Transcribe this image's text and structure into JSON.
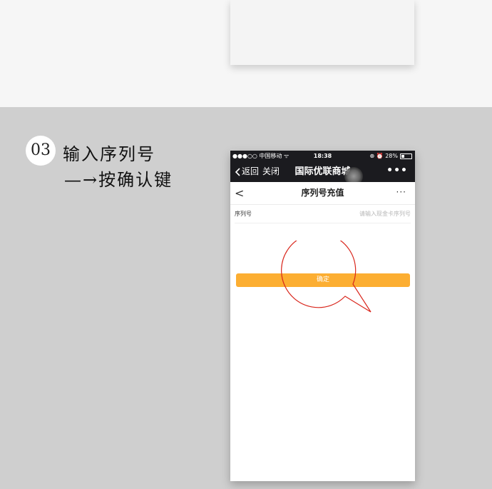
{
  "step": {
    "number": "03",
    "line1": "输入序列号",
    "line2": "—→按确认键"
  },
  "status_bar": {
    "signal_carrier": "●●●○○ 中国移动 ᯤ",
    "time": "18:38",
    "battery_text": "⊕ ⏰ 28%"
  },
  "wechat_nav": {
    "back_label": "返回",
    "close_label": "关闭",
    "title": "国际优联商城",
    "more_label": "•••"
  },
  "page": {
    "back_label": "<",
    "title": "序列号充值",
    "more_label": "···"
  },
  "form": {
    "field_label": "序列号",
    "field_placeholder": "请输入现金卡序列号",
    "field_value": ""
  },
  "confirm_button_label": "确定",
  "colors": {
    "accent": "#fcae32",
    "callout": "#d9261c",
    "bar": "#1b1b1f"
  }
}
